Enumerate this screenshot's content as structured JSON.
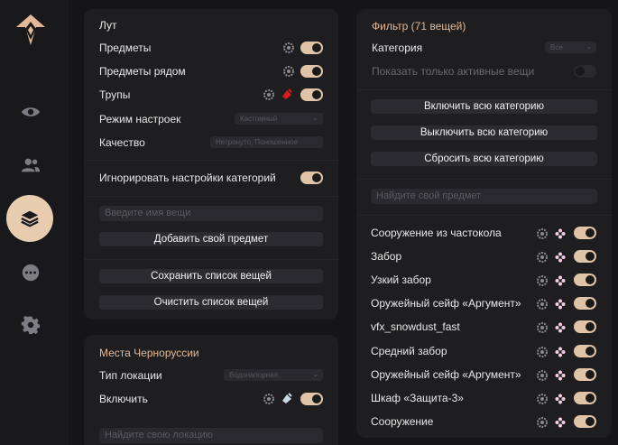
{
  "colors": {
    "accent": "#e3b896",
    "toggle_on": "#e0c4a8",
    "red_icon": "#d81c1c",
    "panel": "#1e1e21"
  },
  "sidebar": {
    "items": [
      {
        "icon": "eye-icon"
      },
      {
        "icon": "users-icon"
      },
      {
        "icon": "layers-icon",
        "active": true
      },
      {
        "icon": "more-icon"
      },
      {
        "icon": "gear-icon"
      }
    ]
  },
  "loot": {
    "title": "Лут",
    "items_label": "Предметы",
    "nearby_label": "Предметы рядом",
    "corpses_label": "Трупы",
    "mode_label": "Режим настроек",
    "mode_value": "Кастомный",
    "quality_label": "Качество",
    "quality_value": "Нетронуто, Поношенное",
    "ignore_label": "Игнорировать настройки категорий",
    "item_name_placeholder": "Введите имя вещи",
    "add_item": "Добавить свой предмет",
    "save_list": "Сохранить список вещей",
    "clear_list": "Очистить список вещей"
  },
  "places": {
    "title": "Места Черноруссии",
    "type_label": "Тип локации",
    "type_value": "Водонапорная",
    "enable_label": "Включить",
    "search_placeholder": "Найдите свою локацию"
  },
  "filter": {
    "title": "Фильтр (71 вещей)",
    "category_label": "Категория",
    "category_value": "Все",
    "only_active_label": "Показать только активные вещи",
    "enable_all": "Включить всю категорию",
    "disable_all": "Выключить всю категорию",
    "reset_all": "Сбросить всю категорию",
    "search_placeholder": "Найдите свой предмет",
    "items": [
      "Сооружение из частокола",
      "Забор",
      "Узкий забор",
      "Оружейный сейф «Аргумент»",
      "vfx_snowdust_fast",
      "Средний забор",
      "Оружейный сейф «Аргумент»",
      "Шкаф «Защита-3»",
      "Сооружение"
    ]
  }
}
